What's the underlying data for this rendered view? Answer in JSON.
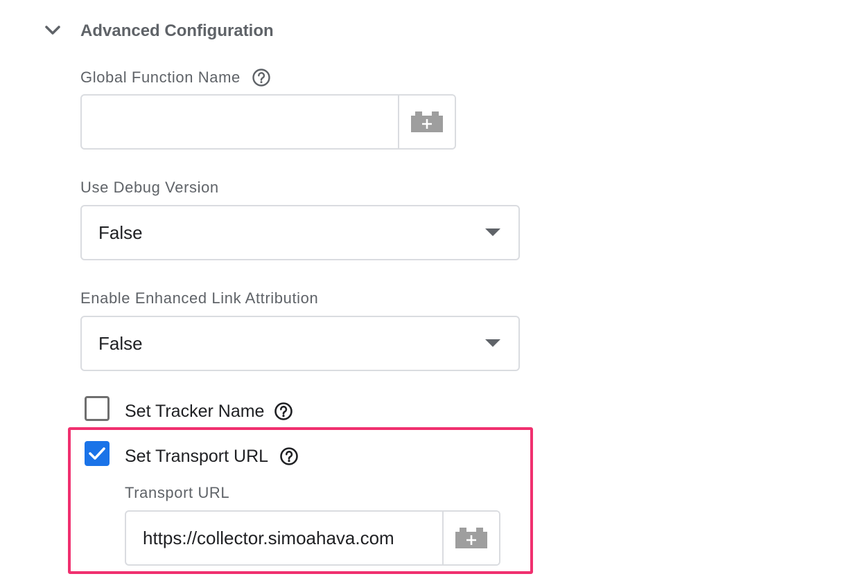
{
  "section": {
    "title": "Advanced Configuration",
    "expanded": true,
    "toggle_icon": "chevron-down-icon"
  },
  "global_function_name": {
    "label": "Global Function Name",
    "help_icon": "help-circle-icon",
    "value": "",
    "variable_icon": "variable-brick-add-icon"
  },
  "use_debug_version": {
    "label": "Use Debug Version",
    "selected": "False",
    "dropdown_icon": "triangle-down-icon"
  },
  "enhanced_link_attribution": {
    "label": "Enable Enhanced Link Attribution",
    "selected": "False",
    "dropdown_icon": "triangle-down-icon"
  },
  "set_tracker_name": {
    "label": "Set Tracker Name",
    "checked": false,
    "help_icon": "help-circle-icon"
  },
  "set_transport_url": {
    "label": "Set Transport URL",
    "checked": true,
    "help_icon": "help-circle-icon",
    "field_label": "Transport URL",
    "value": "https://collector.simoahava.com",
    "variable_icon": "variable-brick-add-icon"
  },
  "colors": {
    "highlight": "#f0306f",
    "checkbox_checked": "#1a73e8",
    "border": "#dadce0",
    "secondary_text": "#5f6368"
  }
}
